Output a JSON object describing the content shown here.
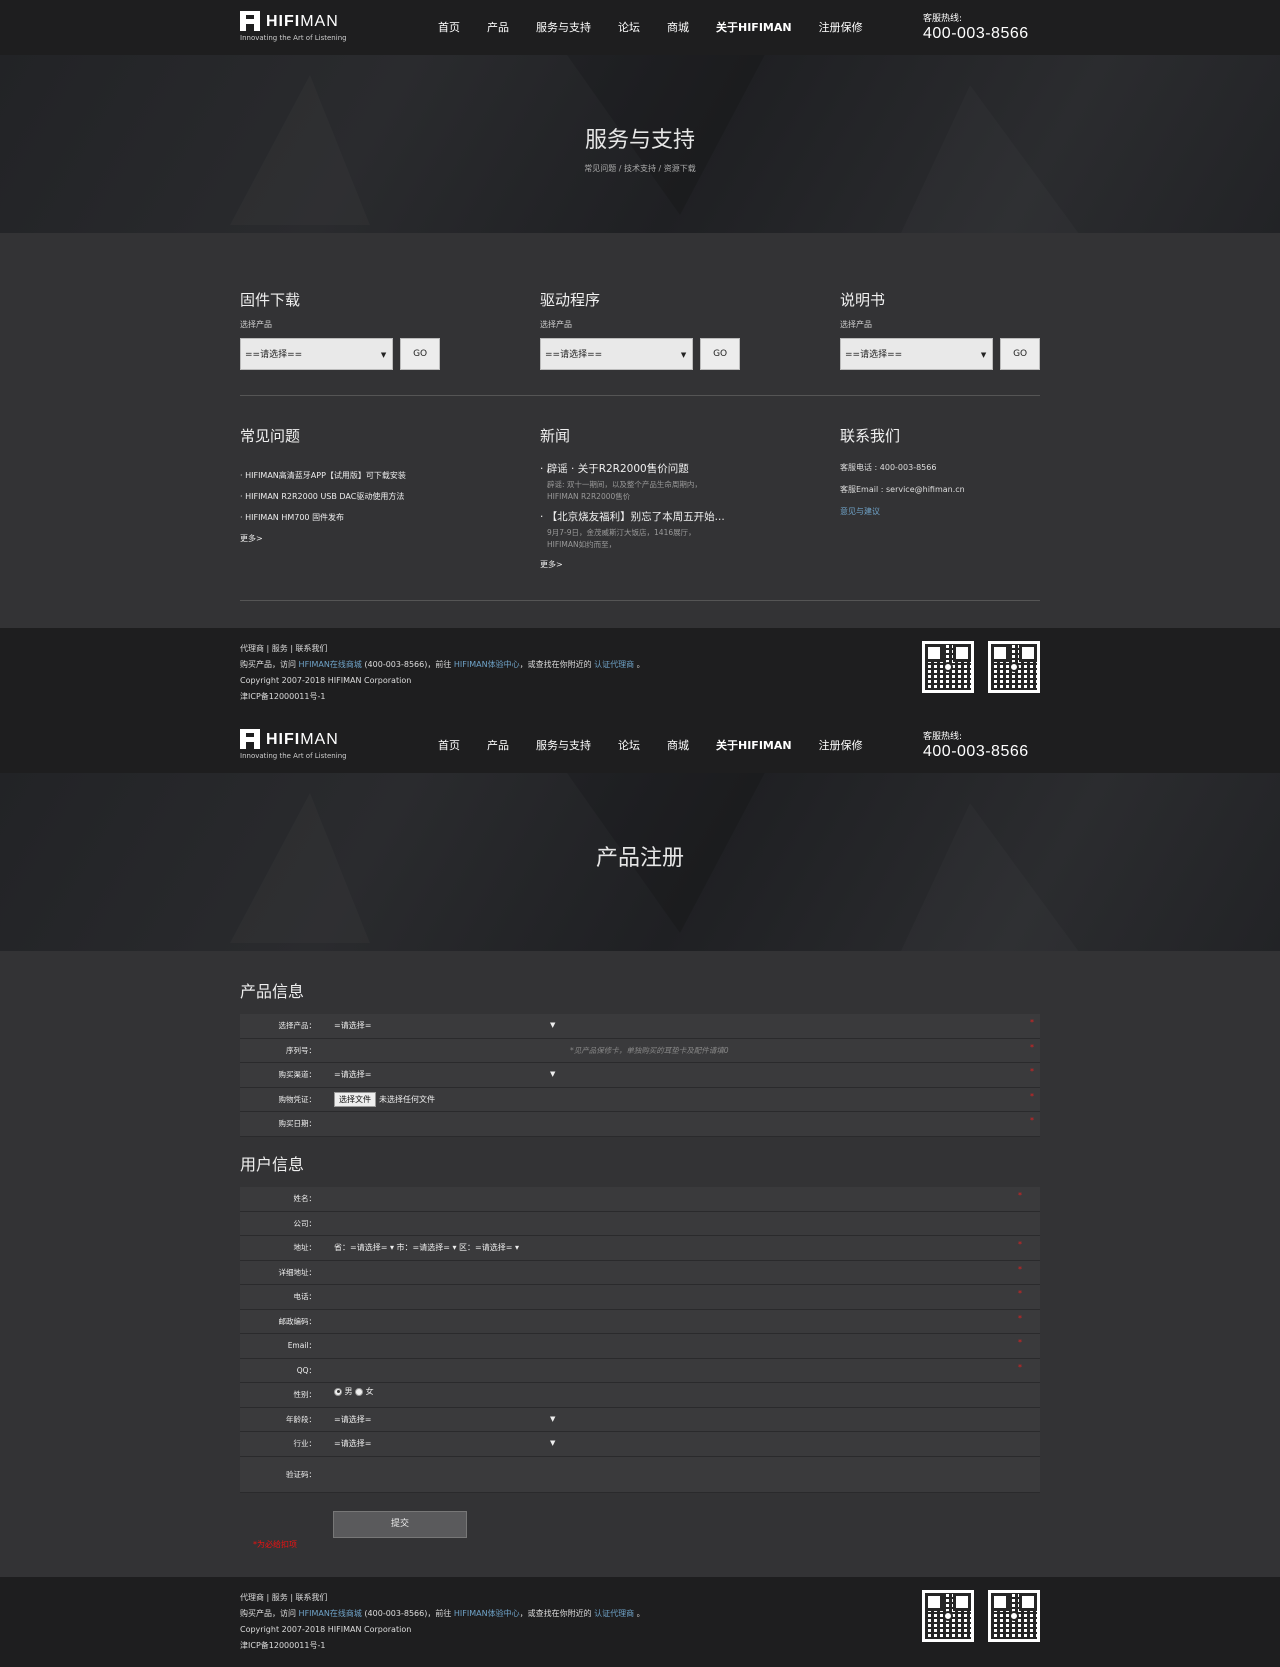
{
  "header": {
    "logo_word_bold": "HIFI",
    "logo_word_rest": "MAN",
    "tagline": "Innovating the Art of Listening",
    "nav": [
      "首页",
      "产品",
      "服务与支持",
      "论坛",
      "商城",
      "关于HIFIMAN",
      "注册保修"
    ],
    "hotline_label": "客服热线:",
    "hotline_number": "400-003-8566"
  },
  "support": {
    "banner_title": "服务与支持",
    "breadcrumb": "常见问题 / 技术支持 / 资源下载",
    "downloads": [
      {
        "title": "固件下载",
        "label": "选择产品",
        "select": "==请选择==",
        "button": "GO"
      },
      {
        "title": "驱动程序",
        "label": "选择产品",
        "select": "==请选择==",
        "button": "GO"
      },
      {
        "title": "说明书",
        "label": "选择产品",
        "select": "==请选择==",
        "button": "GO"
      }
    ],
    "faq": {
      "title": "常见问题",
      "items": [
        "HIFIMAN高清蓝牙APP【试用版】可下载安装",
        "HIFIMAN R2R2000 USB DAC驱动使用方法",
        "HIFIMAN HM700 固件发布"
      ],
      "more": "更多>"
    },
    "news": {
      "title": "新闻",
      "items": [
        {
          "headline": "辟谣 · 关于R2R2000售价问题",
          "desc": "辟谣: 双十一期间，以及整个产品生命周期内，HIFIMAN R2R2000售价"
        },
        {
          "headline": "【北京烧友福利】别忘了本周五开始...",
          "desc": "9月7-9日，金茂威斯汀大饭店，1416展厅，HIFIMAN如约而至，"
        }
      ],
      "more": "更多>"
    },
    "contact": {
      "title": "联系我们",
      "phone": "客服电话 : 400-003-8566",
      "email": "客服Email : service@hifiman.cn",
      "feedback": "意见与建议"
    }
  },
  "footer": {
    "links": "代理商 | 服务 | 联系我们",
    "buy_prefix": "购买产品，访问 ",
    "buy_store": "HFIMAN在线商城",
    "buy_mid": " (400-003-8566)，前往 ",
    "buy_center": "HIFIMAN体验中心",
    "buy_mid2": "，或查找在你附近的 ",
    "buy_agent": "认证代理商",
    "buy_end": " 。",
    "copyright": "Copyright 2007-2018 HIFIMAN Corporation",
    "icp": "津ICP备12000011号-1"
  },
  "register": {
    "banner_title": "产品注册",
    "product_section": "产品信息",
    "product_rows": [
      {
        "label": "选择产品",
        "value": "=请选择=",
        "dropdown": true,
        "required": "*"
      },
      {
        "label": "序列号",
        "hint": "*见产品保修卡，单独购买的耳垫卡及配件请填0",
        "required": "*"
      },
      {
        "label": "购买渠道",
        "value": "=请选择=",
        "dropdown": true,
        "required": "*"
      },
      {
        "label": "购物凭证",
        "file_button": "选择文件",
        "file_status": "未选择任何文件",
        "required": "*"
      },
      {
        "label": "购买日期",
        "required": "*"
      }
    ],
    "user_section": "用户信息",
    "user_rows": [
      {
        "label": "姓名",
        "required": "*"
      },
      {
        "label": "公司"
      },
      {
        "label": "地址",
        "address": "省：=请选择=  ▾   市：=请选择=  ▾   区：=请选择=  ▾",
        "required": "*"
      },
      {
        "label": "详细地址",
        "required": "*"
      },
      {
        "label": "电话",
        "required": "*"
      },
      {
        "label": "邮政编码",
        "required": "*"
      },
      {
        "label": "Email",
        "required": "*"
      },
      {
        "label": "QQ",
        "required": "*"
      },
      {
        "label": "性别",
        "gender_m": "男",
        "gender_f": "女"
      },
      {
        "label": "年龄段",
        "value": "=请选择=",
        "dropdown": true
      },
      {
        "label": "行业",
        "value": "=请选择=",
        "dropdown": true
      },
      {
        "label": "验证码"
      }
    ],
    "submit": "提交",
    "required_note": "*为必给扣项"
  }
}
